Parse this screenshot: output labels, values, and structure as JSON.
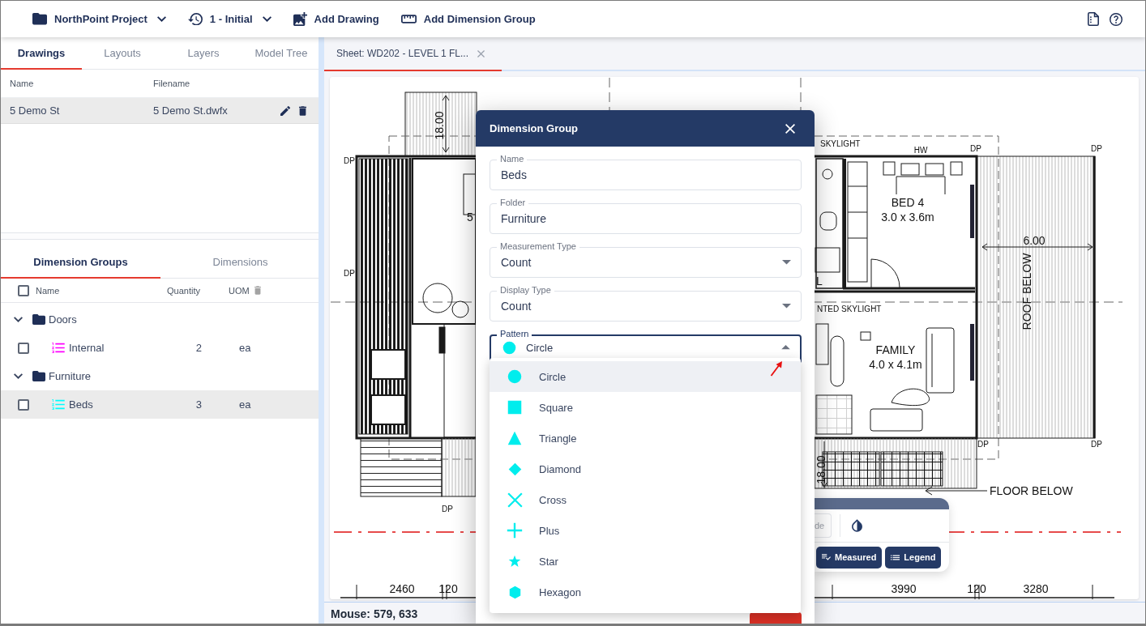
{
  "toolbar": {
    "project": "NorthPoint Project",
    "revision": "1 - Initial",
    "actions": [
      {
        "label": "Add Drawing",
        "kind": "add-drawing"
      },
      {
        "label": "Add Dimension Group",
        "kind": "add-dimension-group"
      }
    ]
  },
  "left_panel": {
    "tabs": [
      {
        "label": "Drawings",
        "selected": true
      },
      {
        "label": "Layouts",
        "selected": false
      },
      {
        "label": "Layers",
        "selected": false
      },
      {
        "label": "Model Tree",
        "selected": false
      }
    ],
    "drawings_table": {
      "columns": [
        "Name",
        "Filename"
      ],
      "rows": [
        {
          "name": "5 Demo St",
          "filename": "5 Demo St.dwfx",
          "selected": true
        }
      ]
    },
    "group_tabs": [
      {
        "label": "Dimension Groups",
        "selected": true
      },
      {
        "label": "Dimensions",
        "selected": false
      }
    ],
    "groups_table": {
      "select_all_checked": false,
      "columns": [
        "Name",
        "Quantity",
        "UOM"
      ],
      "folders": [
        {
          "name": "Doors",
          "expanded": true,
          "children": [
            {
              "name": "Internal",
              "quantity": "2",
              "uom": "ea",
              "color": "#ff00ff",
              "checked": false,
              "selected": false
            }
          ]
        },
        {
          "name": "Furniture",
          "expanded": true,
          "children": [
            {
              "name": "Beds",
              "quantity": "3",
              "uom": "ea",
              "color": "#00ffff",
              "checked": false,
              "selected": true
            }
          ]
        }
      ]
    }
  },
  "sheet_view": {
    "tabs": [
      {
        "label": "Sheet: WD202 - LEVEL 1 FL...",
        "selected": true
      }
    ],
    "plan_labels": [
      "18.00",
      "DP",
      "DP",
      "5",
      "SKYLIGHT",
      "HW",
      "DP",
      "DP",
      "BED 4",
      "3.0 x 3.6m",
      "6.00",
      "ROOF BELOW",
      "L",
      "NTED SKYLIGHT",
      "FAMILY",
      "4.0 x 4.1m",
      "DP",
      "DP",
      "18.00",
      "FLOOR BELOW",
      "DP",
      "2460",
      "120",
      "3990",
      "120",
      "3280"
    ],
    "view_toolbar": {
      "partial_button": "de",
      "buttons": [
        {
          "label": "Measured",
          "kind": "measured"
        },
        {
          "label": "Legend",
          "kind": "legend"
        }
      ]
    },
    "status_bar": {
      "mouse": "Mouse: 579, 633"
    }
  },
  "dialog": {
    "title": "Dimension Group",
    "fields": [
      {
        "label": "Name",
        "value": "Beds",
        "kind": "text"
      },
      {
        "label": "Folder",
        "value": "Furniture",
        "kind": "text"
      },
      {
        "label": "Measurement Type",
        "value": "Count",
        "kind": "select"
      },
      {
        "label": "Display Type",
        "value": "Count",
        "kind": "select"
      }
    ],
    "pattern": {
      "label": "Pattern",
      "value": "Circle",
      "kind": "circle",
      "expanded": true,
      "options": [
        {
          "label": "Circle",
          "kind": "circle",
          "selected": true
        },
        {
          "label": "Square",
          "kind": "square",
          "selected": false
        },
        {
          "label": "Triangle",
          "kind": "triangle",
          "selected": false
        },
        {
          "label": "Diamond",
          "kind": "diamond",
          "selected": false
        },
        {
          "label": "Cross",
          "kind": "cross",
          "selected": false
        },
        {
          "label": "Plus",
          "kind": "plus",
          "selected": false
        },
        {
          "label": "Star",
          "kind": "star",
          "selected": false
        },
        {
          "label": "Hexagon",
          "kind": "hexagon",
          "selected": false
        }
      ]
    }
  }
}
